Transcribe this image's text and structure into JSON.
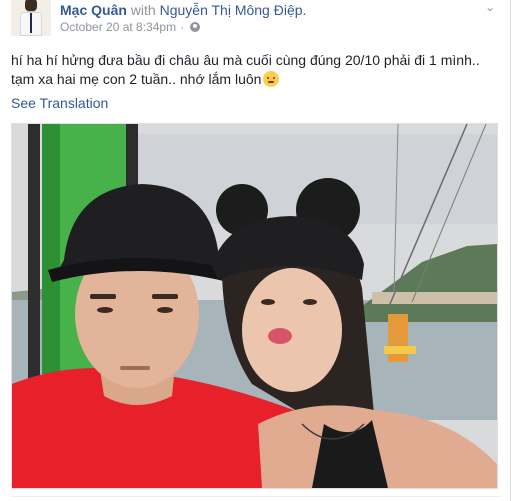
{
  "post": {
    "author": "Mạc Quân",
    "with_label": "with",
    "tagged_person": "Nguyễn Thị Mông Điệp.",
    "timestamp": "October 20 at 8:34pm",
    "separator": "·",
    "audience_icon": "globe-icon",
    "options_icon": "chevron-down-icon",
    "message_lines": [
      "hí ha hí hửng đưa bầu đi châu âu mà cuối cùng đúng 20/10 phải đi 1 mình..",
      "tạm xa hai mẹ con 2 tuần.. nhớ lắm luôn"
    ],
    "message_emoji": "emoji-icon",
    "see_translation": "See Translation",
    "photo": {
      "kind": "selfie in a cable car",
      "colors": {
        "sky": "#d9dadc",
        "sea": "#a7b4ba",
        "cabin_green": "#47b24a",
        "cap": "#1f1f22",
        "shirt": "#e7202a",
        "hair": "#2b2420",
        "skin": "#e2b49a"
      }
    }
  },
  "theme": {
    "link": "#365899",
    "secondary": "#90949c",
    "text": "#1d2129"
  }
}
